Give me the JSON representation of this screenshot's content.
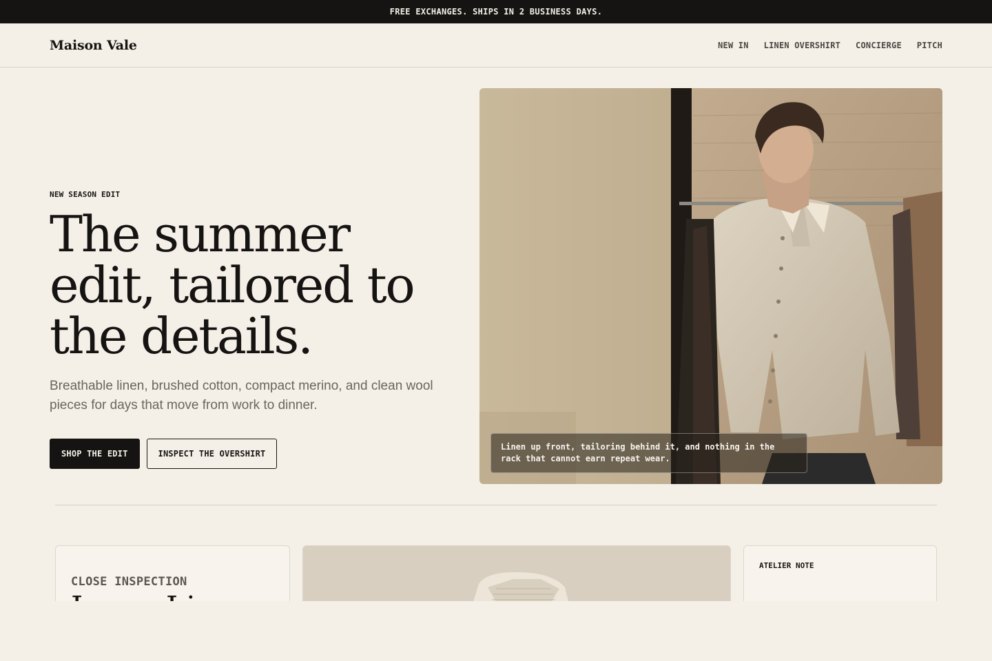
{
  "promo": {
    "text": "FREE EXCHANGES. SHIPS IN 2 BUSINESS DAYS."
  },
  "header": {
    "brand": "Maison Vale",
    "nav": [
      "NEW IN",
      "LINEN OVERSHIRT",
      "CONCIERGE",
      "PITCH"
    ]
  },
  "hero": {
    "eyebrow": "NEW SEASON EDIT",
    "headline_lines": [
      "The summer",
      "edit, tailored to",
      "the details."
    ],
    "subcopy": "Breathable linen, brushed cotton, compact merino, and clean wool pieces for days that move from work to dinner.",
    "cta_primary": "SHOP THE EDIT",
    "cta_secondary": "INSPECT THE OVERSHIRT",
    "image": {
      "subject": "man in linen overshirt in boutique",
      "caption": "Linen up front, tailoring behind it, and nothing in the rack that cannot earn repeat wear."
    }
  },
  "cards": {
    "inspection": {
      "eyebrow": "CLOSE INSPECTION",
      "title_partial": "Loom Li"
    },
    "product_image": {
      "subject": "linen shirt collar close-up"
    },
    "atelier": {
      "eyebrow": "ATELIER NOTE"
    }
  },
  "colors": {
    "background": "#f4f0e8",
    "ink": "#161412",
    "muted": "#6a655d",
    "line": "#d6d0c5"
  }
}
